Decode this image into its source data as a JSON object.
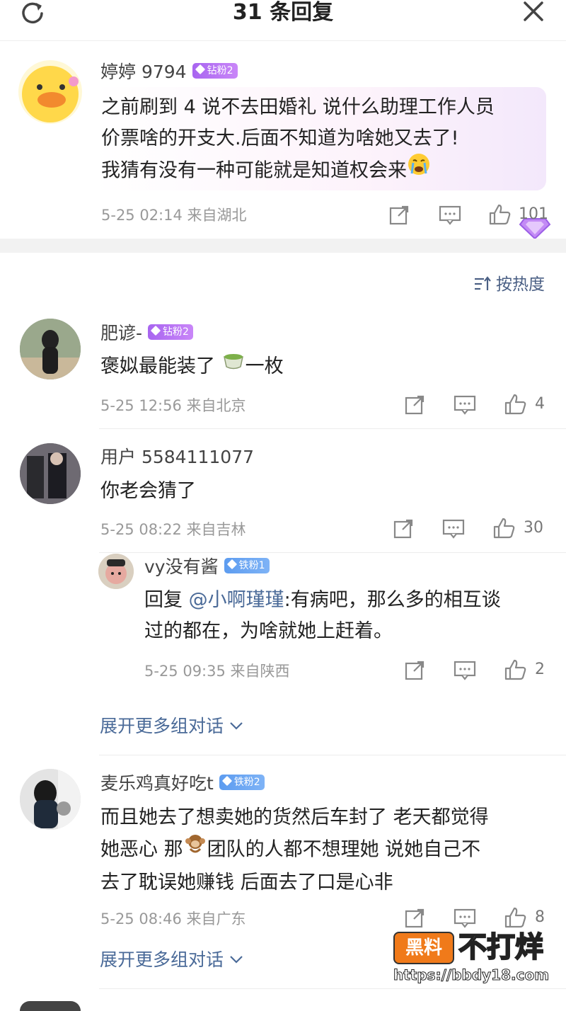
{
  "header": {
    "title": "31 条回复",
    "refresh_icon": "refresh-icon",
    "close_icon": "close-icon"
  },
  "main_reply": {
    "username": "婷婷 9794",
    "badge": "钻粉2",
    "lines": [
      "之前刷到 4 说不去田婚礼 说什么助理工作人员",
      "价票啥的开支大.后面不知道为啥她又去了!",
      "我猜有没有一种可能就是知道权会来"
    ],
    "emoji": "crying-face-emoji",
    "meta": "5-25 02:14 来自湖北",
    "likes": "101"
  },
  "sort_label": "按热度",
  "comments": [
    {
      "username": "肥谚-",
      "badge": "钻粉2",
      "text_before": "褒姒最能装了 ",
      "emoji": "tea-cup-emoji",
      "text_after": "一枚",
      "meta": "5-25 12:56 来自北京",
      "likes": "4"
    },
    {
      "username": "用户 5584111077",
      "text": "你老会猜了",
      "meta": "5-25 08:22 来自吉林",
      "likes": "30",
      "sub_reply": {
        "username": "vy没有酱",
        "badge": "铁粉1",
        "reply_prefix": "回复 ",
        "mention": "@小啊瑾瑾",
        "line1_rest": ":有病吧，那么多的相互谈",
        "line2": "过的都在，为啥就她上赶着。",
        "meta": "5-25 09:35 来自陕西",
        "likes": "2"
      },
      "expand": "展开更多组对话"
    },
    {
      "username": "麦乐鸡真好吃t",
      "badge": "铁粉2",
      "line1": "而且她去了想卖她的货然后车封了 老天都觉得",
      "line2_before": "她恶心 那",
      "emoji": "monkey-emoji",
      "line2_after": "团队的人都不想理她 说她自己不",
      "line3": "去了耽误她赚钱 后面去了口是心非",
      "meta": "5-25 08:46 来自广东",
      "likes": "8",
      "expand": "展开更多组对话"
    }
  ],
  "watermark": {
    "box": "黑料",
    "big": "不打烊",
    "url": "https://bbdy18.com"
  },
  "colors": {
    "diamond_badge": "#a865f0",
    "iron_badge": "#5d9cf0",
    "link": "#4a6a98"
  }
}
